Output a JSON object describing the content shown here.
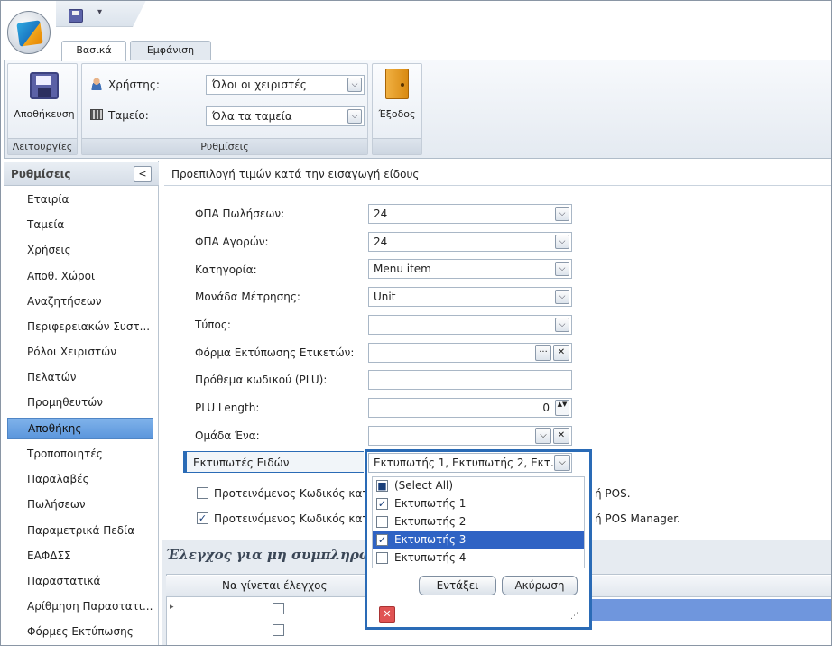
{
  "ribbon": {
    "tabs": [
      "Βασικά",
      "Εμφάνιση"
    ],
    "quick_access_dropdown": "▾",
    "save_label": "Αποθήκευση",
    "exit_label": "Έξοδος",
    "group_operations": "Λειτουργίες",
    "group_settings": "Ρυθμίσεις",
    "user_label": "Χρήστης:",
    "user_value": "Όλοι οι χειριστές",
    "register_label": "Ταμείο:",
    "register_value": "Όλα τα ταμεία"
  },
  "sidebar": {
    "title": "Ρυθμίσεις",
    "collapse": "<",
    "items": [
      "Εταιρία",
      "Ταμεία",
      "Χρήσεις",
      "Αποθ. Χώροι",
      "Αναζητήσεων",
      "Περιφερειακών Συστ...",
      "Ρόλοι Χειριστών",
      "Πελατών",
      "Προμηθευτών",
      "Αποθήκης",
      "Τροποποιητές",
      "Παραλαβές",
      "Πωλήσεων",
      "Παραμετρικά Πεδία",
      "ΕΑΦΔΣΣ",
      "Παραστατικά",
      "Αρίθμηση Παραστατι...",
      "Φόρμες Εκτύπωσης"
    ],
    "active_index": 9
  },
  "main": {
    "title": "Προεπιλογή τιμών κατά την εισαγωγή είδους",
    "fields": {
      "vat_sales_label": "ΦΠΑ Πωλήσεων:",
      "vat_sales_value": "24",
      "vat_purchases_label": "ΦΠΑ Αγορών:",
      "vat_purchases_value": "24",
      "category_label": "Κατηγορία:",
      "category_value": "Menu item",
      "unit_label": "Μονάδα Μέτρησης:",
      "unit_value": "Unit",
      "type_label": "Τύπος:",
      "type_value": "",
      "label_form_label": "Φόρμα Εκτύπωσης Ετικετών:",
      "label_form_value": "",
      "plu_prefix_label": "Πρόθεμα κωδικού (PLU):",
      "plu_prefix_value": "",
      "plu_length_label": "PLU Length:",
      "plu_length_value": "0",
      "group_one_label": "Ομάδα Ένα:",
      "group_one_value": "",
      "printers_label": "Εκτυπωτές Ειδών"
    },
    "checkbox1_left": "Προτεινόμενος Κωδικός κατά τ",
    "checkbox1_right": "ή POS.",
    "checkbox2_left": "Προτεινόμενος Κωδικός κατά τ",
    "checkbox2_right": "ή POS Manager.",
    "lower_title": "Έλεγχος για μη συμπληρωμέ",
    "grid_column": "Να γίνεται έλεγχος",
    "grid_row_marker": "▸"
  },
  "popup": {
    "combo_value": "Εκτυπωτής 1, Εκτυπωτής 2, Εκτ...",
    "options": [
      {
        "label": "(Select All)",
        "mark": "■"
      },
      {
        "label": "Εκτυπωτής 1",
        "mark": "✓"
      },
      {
        "label": "Εκτυπωτής 2",
        "mark": ""
      },
      {
        "label": "Εκτυπωτής 3",
        "mark": "✓"
      },
      {
        "label": "Εκτυπωτής 4",
        "mark": ""
      }
    ],
    "selected_index": 3,
    "ok_label": "Εντάξει",
    "cancel_label": "Ακύρωση",
    "clear_icon": "✕",
    "grip": "⋰"
  },
  "icons": {
    "combo_arrow": "⌵",
    "ellipsis": "···",
    "clear": "✕",
    "spin": "▲▼"
  },
  "colors": {
    "accent": "#2a6bb6",
    "selection": "#2f63c4",
    "active_nav": "#5b96dc"
  }
}
